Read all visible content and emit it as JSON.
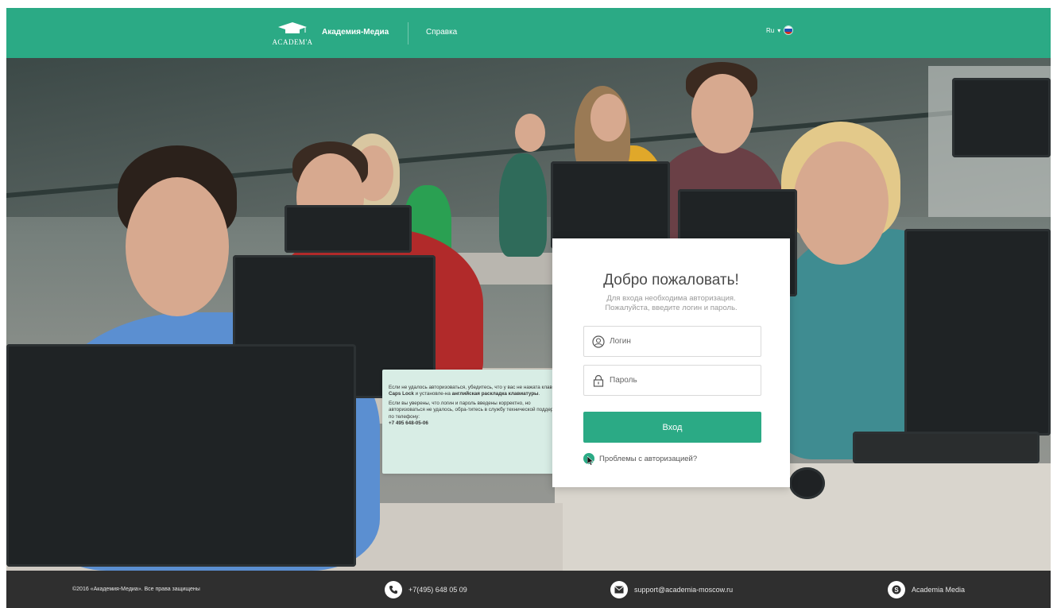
{
  "header": {
    "logo_text": "ACADEM'A",
    "brand": "Академия-Медиа",
    "help_link": "Справка",
    "language": "Ru",
    "colors": {
      "accent": "#2baa85"
    }
  },
  "login": {
    "title": "Добро пожаловать!",
    "subtitle_line1": "Для входа необходима авторизация.",
    "subtitle_line2": "Пожалуйста, введите логин и пароль.",
    "login_placeholder": "Логин",
    "password_placeholder": "Пароль",
    "submit_label": "Вход",
    "problems_link": "Проблемы с авторизацией?",
    "icons": {
      "login": "user-circle-icon",
      "password": "lock-icon"
    }
  },
  "tooltip": {
    "p1_a": "Если не удалось авторизоваться, убедитесь, что у вас не нажата клавиша ",
    "p1_b": "Caps Lock",
    "p1_c": " и установле-на ",
    "p1_d": "английская раскладка клавиатуры",
    "p1_e": ".",
    "p2": "Если вы уверены, что логин и пароль введены корректно, но авторизоваться не удалось, обра-титесь в службу технической поддержки по телефону:",
    "phone": "+7 495 648-05-06"
  },
  "footer": {
    "copyright": "©2016 «Академия-Медиа». Все права защищены",
    "phone": "+7(495) 648 05 09",
    "email": "support@academia-moscow.ru",
    "skype": "Academia Media"
  }
}
